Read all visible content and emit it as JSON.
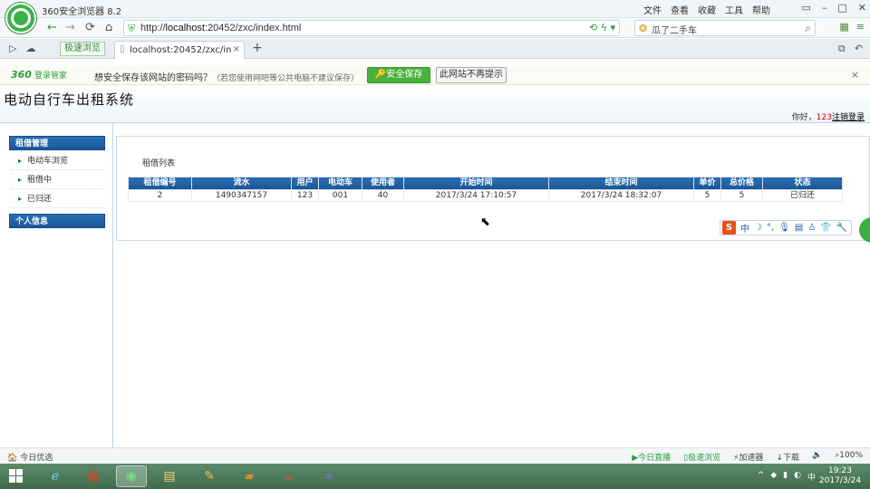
{
  "browser": {
    "title": "360安全浏览器 8.2",
    "menu": [
      "文件",
      "查看",
      "收藏",
      "工具",
      "帮助"
    ],
    "url_prefix": "http://",
    "url_host": "localhost",
    "url_path": ":20452/zxc/index.html",
    "search_text": "瓜了二手车",
    "mode_label": "极速浏览",
    "tab_label": "localhost:20452/zxc/index.htm",
    "tab_close": "×",
    "new_tab": "+"
  },
  "notification": {
    "brand": "360",
    "brand_sub": "登录管家",
    "message": "想安全保存该网站的密码吗？",
    "hint": "（若您使用网吧等公共电脑不建议保存）",
    "save_label": "安全保存",
    "never_label": "此网站不再提示",
    "close": "×"
  },
  "header": {
    "title": "电动自行车出租系统",
    "welcome_prefix": "你好，",
    "user": "123",
    "logout": "注销登录"
  },
  "sidebar": {
    "section1": "租借管理",
    "items": [
      "电动车浏览",
      "租借中",
      "已归还"
    ],
    "section2": "个人信息"
  },
  "main": {
    "panel_title": "租借列表",
    "columns": [
      "租借编号",
      "流水",
      "用户",
      "电动车",
      "使用者",
      "开始时间",
      "结束时间",
      "单价",
      "总价格",
      "状态"
    ],
    "rows": [
      [
        "2",
        "1490347157",
        "123",
        "001",
        "40",
        "2017/3/24 17:10:57",
        "2017/3/24 18:32:07",
        "5",
        "5",
        "已归还"
      ]
    ]
  },
  "ime": {
    "logo": "S",
    "mode": "中"
  },
  "status": {
    "left": "今日优选",
    "items": [
      "今日直播",
      "极速浏览",
      "加速器",
      "下载",
      "100%"
    ]
  },
  "taskbar": {
    "time": "19:23",
    "date": "2017/3/24"
  }
}
